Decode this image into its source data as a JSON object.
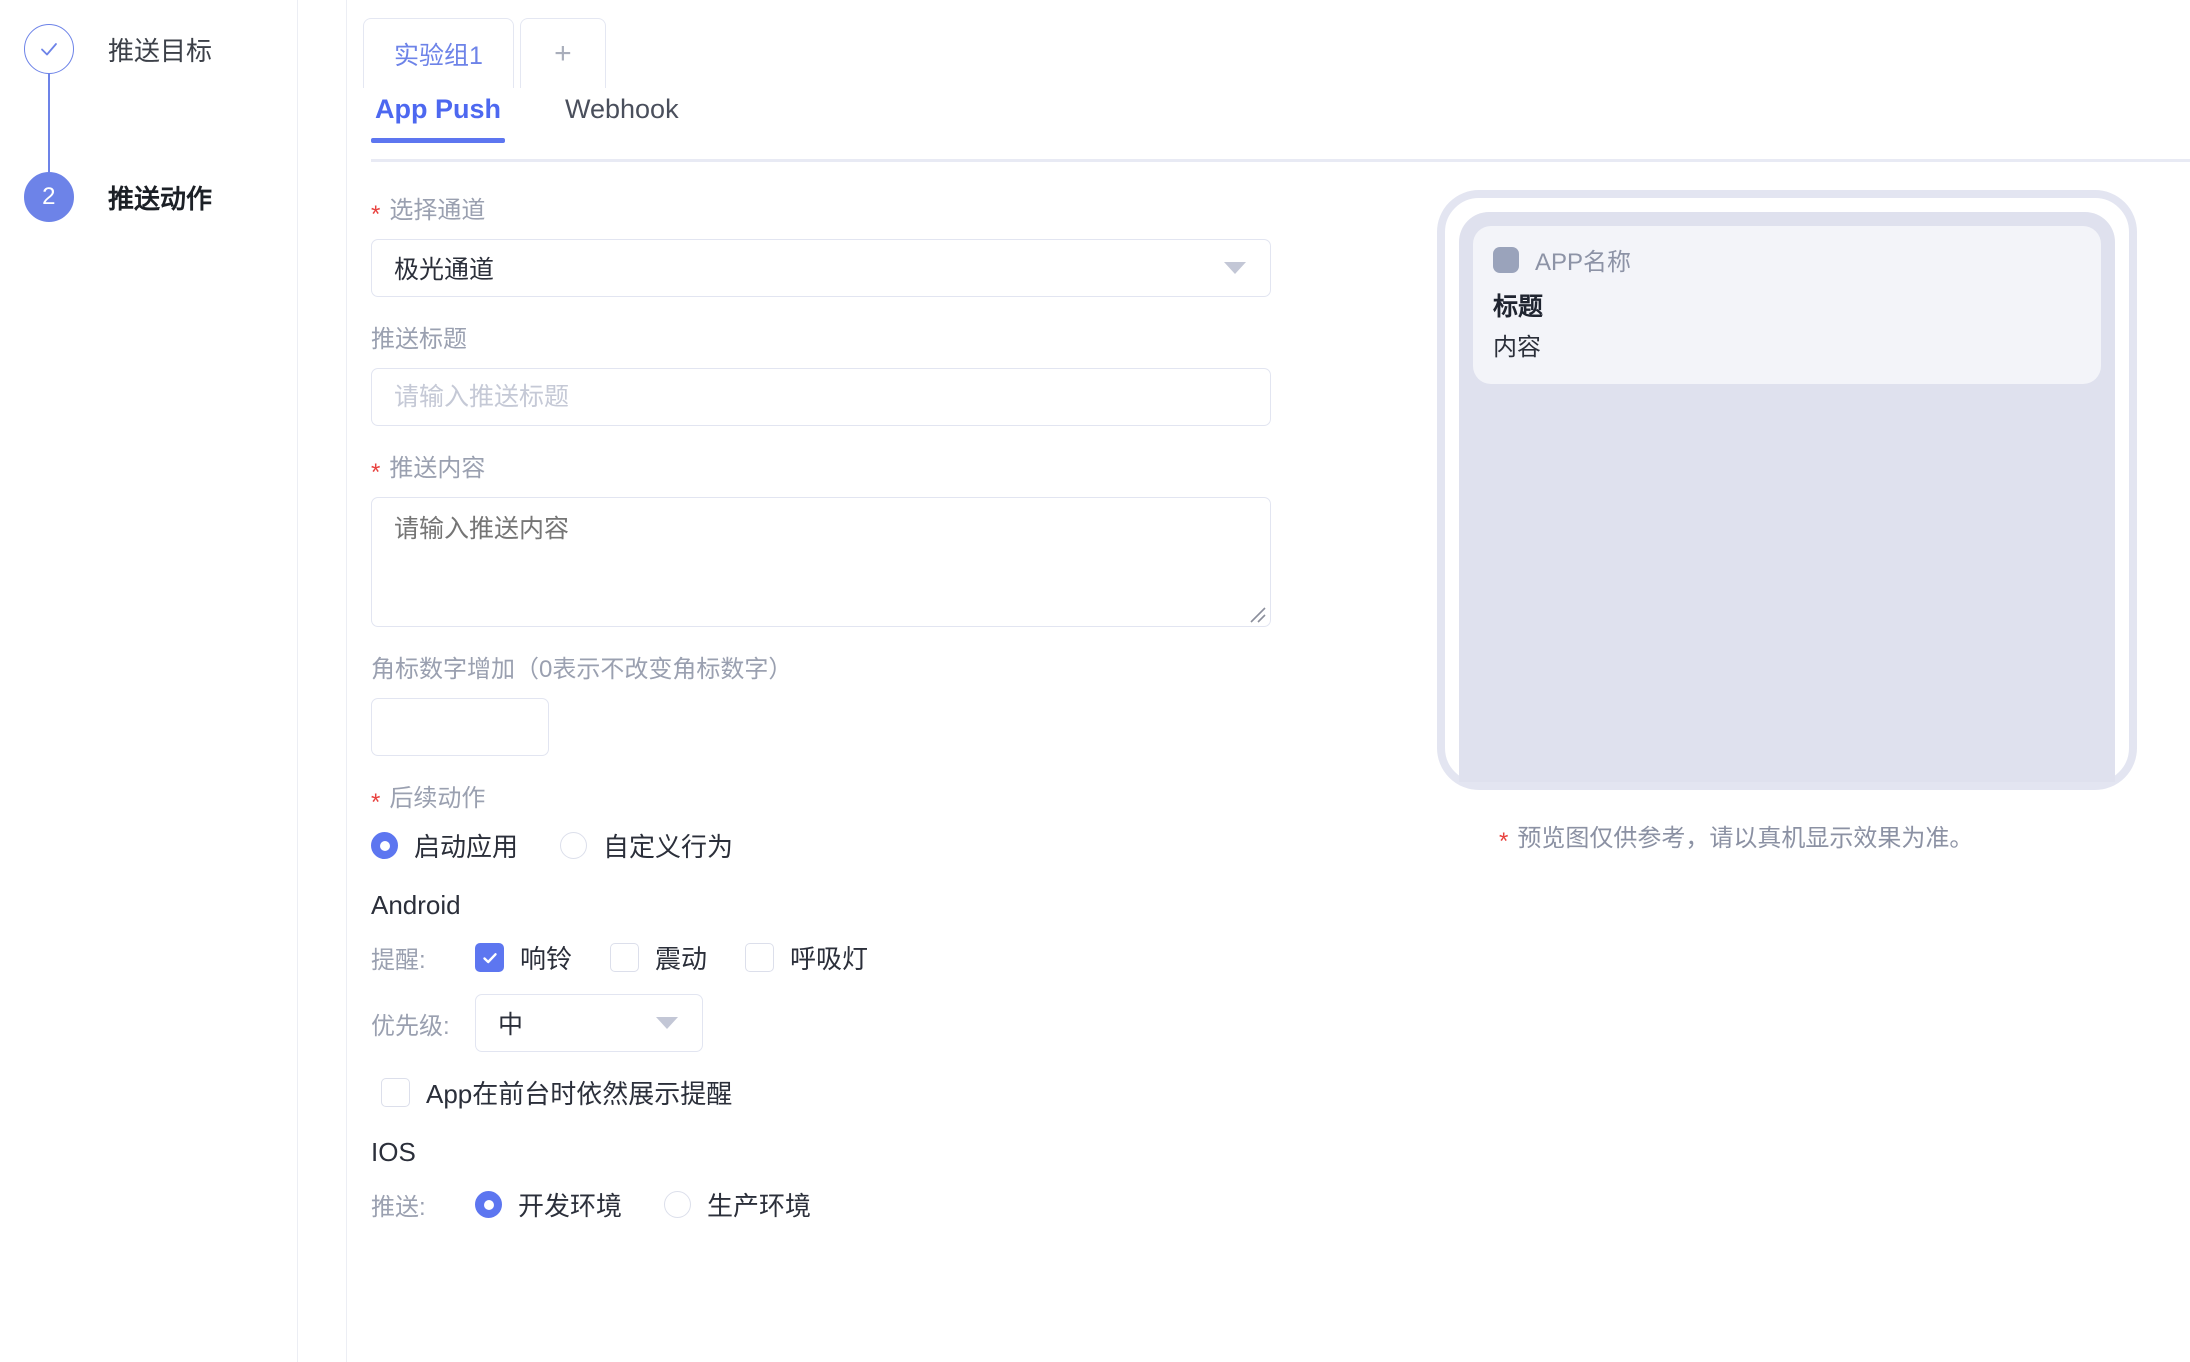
{
  "stepper": {
    "steps": [
      {
        "marker": "check-icon",
        "label": "推送目标",
        "state": "done"
      },
      {
        "marker": "2",
        "label": "推送动作",
        "state": "current"
      }
    ]
  },
  "group_tabs": {
    "tabs": [
      {
        "label": "实验组1",
        "active": true
      }
    ],
    "add_label": "+"
  },
  "inner_tabs": {
    "tabs": [
      {
        "label": "App Push",
        "active": true
      },
      {
        "label": "Webhook",
        "active": false
      }
    ]
  },
  "form": {
    "channel": {
      "label": "选择通道",
      "required": true,
      "value": "极光通道",
      "caret": "chevron-down-icon"
    },
    "push_title": {
      "label": "推送标题",
      "required": false,
      "value": "",
      "placeholder": "请输入推送标题"
    },
    "push_content": {
      "label": "推送内容",
      "required": true,
      "value": "",
      "placeholder": "请输入推送内容"
    },
    "badge": {
      "label": "角标数字增加（0表示不改变角标数字）",
      "required": false,
      "value": "",
      "placeholder": ""
    },
    "follow_action": {
      "label": "后续动作",
      "required": true,
      "options": [
        {
          "label": "启动应用",
          "checked": true
        },
        {
          "label": "自定义行为",
          "checked": false
        }
      ]
    },
    "android": {
      "title": "Android",
      "remind_label": "提醒:",
      "remind_options": [
        {
          "label": "响铃",
          "checked": true
        },
        {
          "label": "震动",
          "checked": false
        },
        {
          "label": "呼吸灯",
          "checked": false
        }
      ],
      "priority_label": "优先级:",
      "priority_value": "中",
      "foreground": {
        "label": "App在前台时依然展示提醒",
        "checked": false
      }
    },
    "ios": {
      "title": "IOS",
      "push_label": "推送:",
      "env_options": [
        {
          "label": "开发环境",
          "checked": true
        },
        {
          "label": "生产环境",
          "checked": false
        }
      ]
    }
  },
  "preview": {
    "app_name": "APP名称",
    "notif_title": "标题",
    "notif_body": "内容",
    "note": "预览图仅供参考，请以真机显示效果为准。"
  },
  "colors": {
    "accent": "#6d83e8",
    "tab_active": "#4d68f0",
    "required_star": "#e8423f",
    "checkbox_checked": "#5d76f0"
  }
}
